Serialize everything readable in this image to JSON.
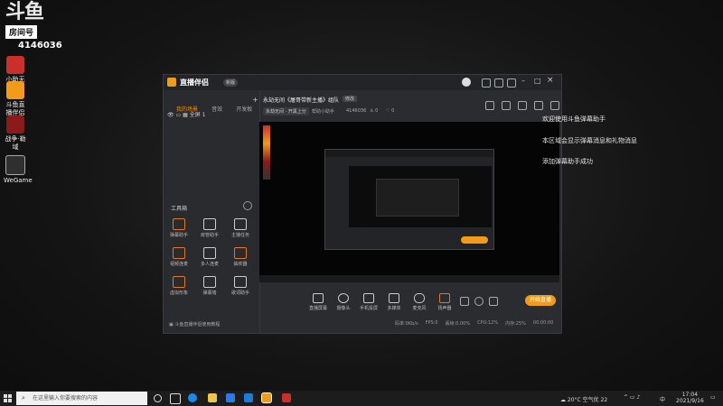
{
  "overlay": {
    "logo_text": "斗鱼",
    "room_label": "房间号",
    "room_id": "4146036"
  },
  "desktop_icons": [
    {
      "label": "小助无间",
      "color": "#c9302c"
    },
    {
      "label": "斗鱼直播伴侣",
      "color": "#f29b1b"
    },
    {
      "label": "战争·勒域",
      "color": "#8b1a1a"
    },
    {
      "label": "WeGame",
      "color": "#2f2f2f"
    }
  ],
  "app": {
    "brand": "直播伴侣",
    "beta": "新版",
    "tabs": [
      "我的场景",
      "音效",
      "开发板"
    ],
    "scene_label": "全屏 1",
    "stream_title": "永劫无间《屠哥带新主播》组队",
    "title_badge": "修改",
    "category": "永劫无间 · 开黑上分",
    "secondary": "帮助小助手",
    "room_id": "4146036",
    "stat1": "0",
    "stat2": "0",
    "toolbox_title": "工具箱",
    "tools": [
      {
        "label": "弹幕助手",
        "accent": true
      },
      {
        "label": "房管助手",
        "accent": false
      },
      {
        "label": "主播任务",
        "accent": false
      },
      {
        "label": "视频连麦",
        "accent": true
      },
      {
        "label": "多人连麦",
        "accent": false
      },
      {
        "label": "抽奖器",
        "accent": true
      },
      {
        "label": "虚拟形象",
        "accent": true
      },
      {
        "label": "弹幕墙",
        "accent": false
      },
      {
        "label": "歌词助手",
        "accent": false
      }
    ],
    "footer_link": "斗鱼直播伴侣使用教程",
    "bottom_tools": [
      "直播屏幕",
      "摄像头",
      "手机投屏",
      "多媒体",
      "麦克风",
      "扬声器"
    ],
    "status": [
      "码率:0Kb/s",
      "FPS:0",
      "丢帧:0.00%",
      "CPU:12%",
      "内存:25%"
    ],
    "timer": "00:00:00",
    "start_button": "开始直播"
  },
  "chat_lines": [
    "欢迎使用斗鱼弹幕助手",
    "本区域会显示弹幕消息和礼物消息",
    "添加弹幕助手成功"
  ],
  "taskbar": {
    "search_placeholder": "在这里输入你要搜索的内容",
    "weather": "20°C 空气优 22",
    "lang": "中",
    "time": "17:04",
    "date": "2021/9/16"
  }
}
